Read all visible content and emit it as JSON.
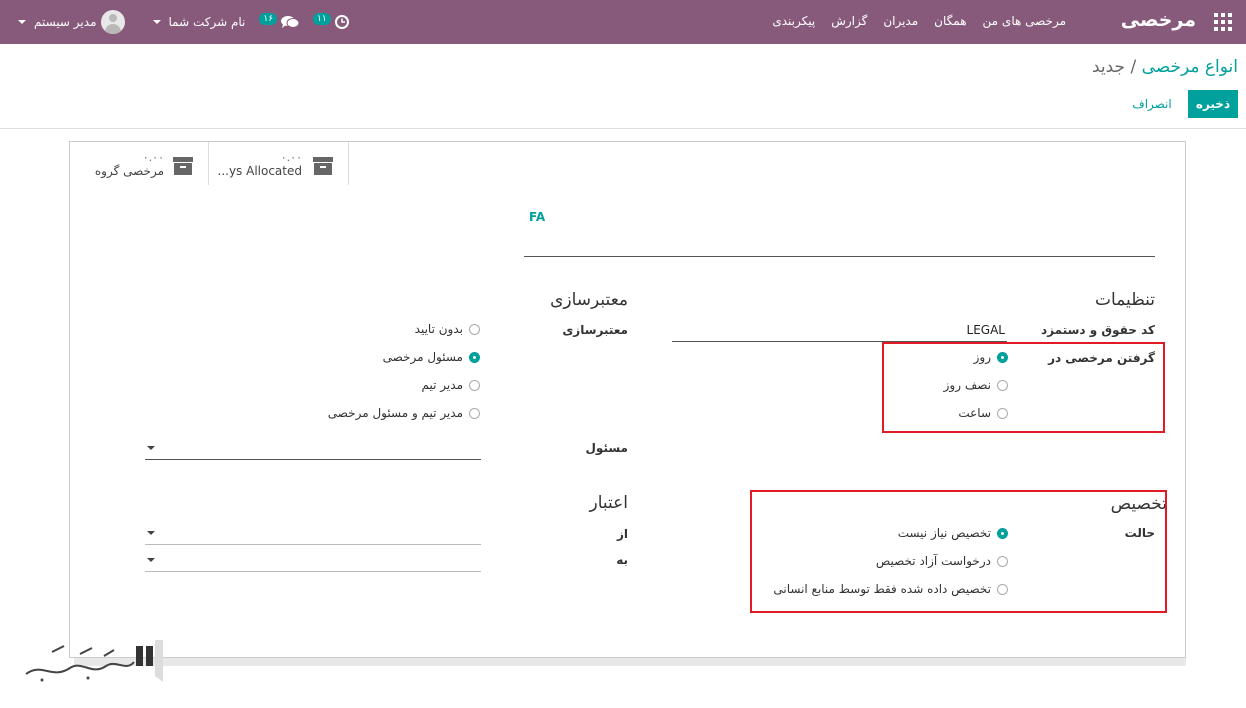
{
  "navbar": {
    "brand": "مرخصی",
    "menu": [
      "مرخصی های من",
      "همگان",
      "مدیران",
      "گزارش",
      "پیکربندی"
    ],
    "company": "نام شرکت شما",
    "user": "مدیر سیستم",
    "activity_count": "۱۱",
    "messages_count": "۱۶"
  },
  "breadcrumb": {
    "parent": "انواع مرخصی",
    "separator": "/",
    "current": "جدید"
  },
  "buttons": {
    "save": "ذخیره",
    "discard": "انصراف"
  },
  "smart_buttons": [
    {
      "value": "۰.۰۰",
      "label": "...ys Allocated"
    },
    {
      "value": "۰.۰۰",
      "label": "مرخصی گروه"
    }
  ],
  "name_field": {
    "label": "FA"
  },
  "settings": {
    "title": "تنظیمات",
    "payroll_code_label": "کد حقوق و دستمزد",
    "payroll_code_value": "LEGAL",
    "take_leave_label": "گرفتن مرخصی در",
    "take_leave_options": [
      {
        "label": "روز",
        "checked": true
      },
      {
        "label": "نصف روز",
        "checked": false
      },
      {
        "label": "ساعت",
        "checked": false
      }
    ]
  },
  "validation": {
    "title": "معتبرسازی",
    "label": "معتبرسازی",
    "options": [
      {
        "label": "بدون تایید",
        "checked": false
      },
      {
        "label": "مسئول مرخصی",
        "checked": true
      },
      {
        "label": "مدیر تیم",
        "checked": false
      },
      {
        "label": "مدیر تیم و مسئول مرخصی",
        "checked": false
      }
    ],
    "responsible_label": "مسئول"
  },
  "allocation": {
    "title": "تخصیص",
    "mode_label": "حالت",
    "options": [
      {
        "label": "تخصیص نیاز نیست",
        "checked": true
      },
      {
        "label": "درخواست آزاد تخصیص",
        "checked": false
      },
      {
        "label": "تخصیص داده شده فقط توسط منابع انسانی",
        "checked": false
      }
    ]
  },
  "validity": {
    "title": "اعتبار",
    "from_label": "از",
    "to_label": "به"
  },
  "colors": {
    "navbar": "#875a7b",
    "accent": "#00a09d",
    "highlight": "#e01b24"
  }
}
